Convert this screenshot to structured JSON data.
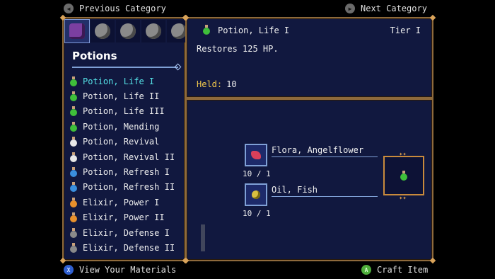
{
  "top_bar": {
    "prev_label": "Previous Category",
    "next_label": "Next Category"
  },
  "category": {
    "title": "Potions",
    "tabs": [
      {
        "icon": "potion-icon",
        "active": true
      },
      {
        "icon": "creature-icon",
        "active": false
      },
      {
        "icon": "creature-icon",
        "active": false
      },
      {
        "icon": "creature-icon",
        "active": false
      },
      {
        "icon": "creature-icon",
        "active": false
      }
    ]
  },
  "items": [
    {
      "label": "Potion, Life I",
      "color": "#3fbf3a",
      "selected": true
    },
    {
      "label": "Potion, Life II",
      "color": "#3fbf3a"
    },
    {
      "label": "Potion, Life III",
      "color": "#3fbf3a"
    },
    {
      "label": "Potion, Mending",
      "color": "#3fbf3a"
    },
    {
      "label": "Potion, Revival",
      "color": "#e8e8e8"
    },
    {
      "label": "Potion, Revival II",
      "color": "#e8e8e8"
    },
    {
      "label": "Potion, Refresh I",
      "color": "#3a8fdf"
    },
    {
      "label": "Potion, Refresh II",
      "color": "#3a8fdf"
    },
    {
      "label": "Elixir, Power I",
      "color": "#e8902c"
    },
    {
      "label": "Elixir, Power II",
      "color": "#e8902c"
    },
    {
      "label": "Elixir, Defense I",
      "color": "#8a8a8a"
    },
    {
      "label": "Elixir, Defense II",
      "color": "#8a8a8a"
    }
  ],
  "detail": {
    "name": "Potion, Life I",
    "tier": "Tier I",
    "description": "Restores 125 HP.",
    "held_label": "Held:",
    "held_value": "10"
  },
  "recipe": {
    "materials": [
      {
        "name": "Flora, Angelflower",
        "count": "10 / 1",
        "icon": "flower-icon",
        "color": "#d8405a"
      },
      {
        "name": "Oil, Fish",
        "count": "10 / 1",
        "icon": "oil-icon",
        "color": "#d8c040"
      }
    ],
    "result_icon": "potion-icon"
  },
  "bottom_bar": {
    "left_label": "View Your Materials",
    "right_label": "Craft Item",
    "left_button": "X",
    "right_button": "A"
  },
  "colors": {
    "panel_bg": "#11183f",
    "border": "#8e6a3c",
    "selected_text": "#55e1e6",
    "held_label": "#f2c94c"
  }
}
